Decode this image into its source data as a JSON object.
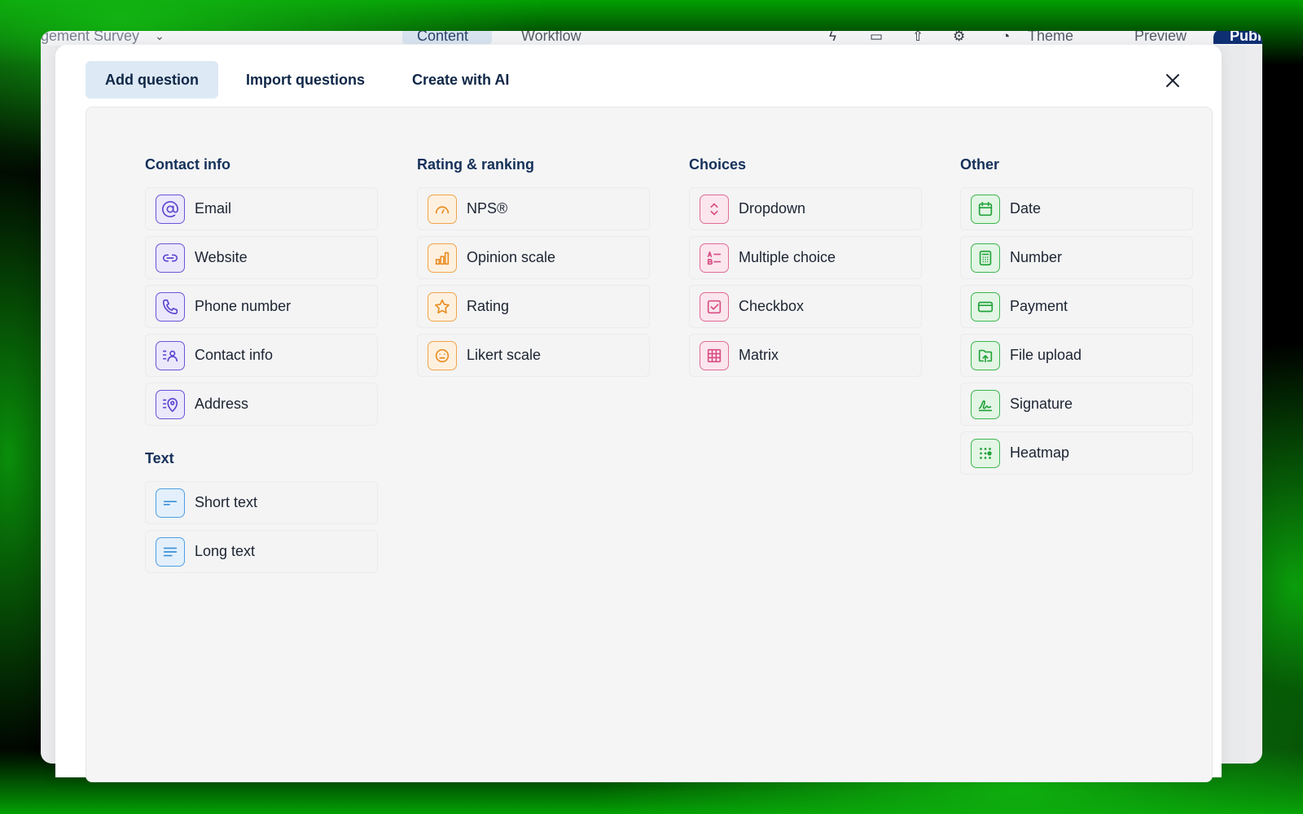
{
  "background_app": {
    "survey_name": "gement Survey",
    "tabs": [
      "Content",
      "Workflow"
    ],
    "actions": {
      "theme": "Theme",
      "preview": "Preview",
      "publish": "Publ"
    }
  },
  "modal": {
    "tabs": [
      {
        "label": "Add question",
        "active": true
      },
      {
        "label": "Import questions",
        "active": false
      },
      {
        "label": "Create with AI",
        "active": false
      }
    ],
    "close_icon": "close-icon"
  },
  "sections": {
    "contact": {
      "title": "Contact info",
      "color": "#5b45d0",
      "items": [
        {
          "label": "Email",
          "icon": "at-sign-icon"
        },
        {
          "label": "Website",
          "icon": "link-icon"
        },
        {
          "label": "Phone number",
          "icon": "phone-icon"
        },
        {
          "label": "Contact info",
          "icon": "contact-card-icon"
        },
        {
          "label": "Address",
          "icon": "map-pin-icon"
        }
      ]
    },
    "text": {
      "title": "Text",
      "color": "#3a8fd8",
      "items": [
        {
          "label": "Short text",
          "icon": "short-text-icon"
        },
        {
          "label": "Long text",
          "icon": "long-text-icon"
        }
      ]
    },
    "rating": {
      "title": "Rating & ranking",
      "color": "#e88d22",
      "items": [
        {
          "label": "NPS®",
          "icon": "gauge-icon"
        },
        {
          "label": "Opinion scale",
          "icon": "bar-chart-icon"
        },
        {
          "label": "Rating",
          "icon": "star-icon"
        },
        {
          "label": "Likert scale",
          "icon": "smiley-icon"
        }
      ]
    },
    "choices": {
      "title": "Choices",
      "color": "#d84e82",
      "items": [
        {
          "label": "Dropdown",
          "icon": "dropdown-icon"
        },
        {
          "label": "Multiple choice",
          "icon": "multiple-choice-icon"
        },
        {
          "label": "Checkbox",
          "icon": "checkbox-icon"
        },
        {
          "label": "Matrix",
          "icon": "grid-icon"
        }
      ]
    },
    "other": {
      "title": "Other",
      "color": "#22a33a",
      "items": [
        {
          "label": "Date",
          "icon": "calendar-icon"
        },
        {
          "label": "Number",
          "icon": "calculator-icon"
        },
        {
          "label": "Payment",
          "icon": "credit-card-icon"
        },
        {
          "label": "File upload",
          "icon": "upload-icon"
        },
        {
          "label": "Signature",
          "icon": "signature-icon"
        },
        {
          "label": "Heatmap",
          "icon": "heatmap-icon"
        }
      ]
    }
  }
}
